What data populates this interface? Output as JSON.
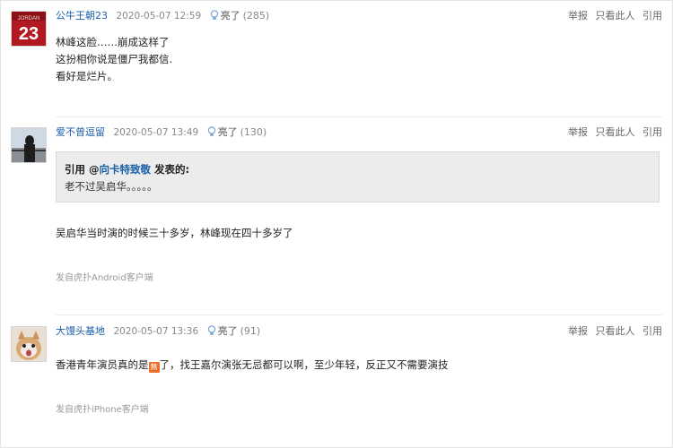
{
  "posts": [
    {
      "username": "公牛王朝23",
      "time": "2020-05-07 12:59",
      "light_label": "亮了",
      "light_count": "(285)",
      "actions": [
        "举报",
        "只看此人",
        "引用"
      ],
      "lines": [
        "林峰这脸……崩成这样了",
        "这扮相你说是僵尸我都信.",
        "看好是烂片。"
      ]
    },
    {
      "username": "爱不曾逗留",
      "time": "2020-05-07 13:49",
      "light_label": "亮了",
      "light_count": "(130)",
      "actions": [
        "举报",
        "只看此人",
        "引用"
      ],
      "quote": {
        "prefix": "引用 @",
        "user": "向卡特致敬",
        "suffix": " 发表的:",
        "text": "老不过吴启华。。。。。"
      },
      "lines": [
        "吴启华当时演的时候三十多岁，林峰现在四十多岁了"
      ],
      "source": "发自虎扑Android客户端"
    },
    {
      "username": "大馒头基地",
      "time": "2020-05-07 13:36",
      "light_label": "亮了",
      "light_count": "(91)",
      "actions": [
        "举报",
        "只看此人",
        "引用"
      ],
      "text_a": "香港青年演员真的是",
      "emoji": "無",
      "text_b": "了，找王嘉尔演张无忌都可以啊，至少年轻，反正又不需要演技",
      "source": "发自虎扑iPhone客户端"
    }
  ],
  "colors": {
    "link": "#1a5fa8",
    "quote_bg": "#ececec",
    "emoji": "#e8702a"
  }
}
